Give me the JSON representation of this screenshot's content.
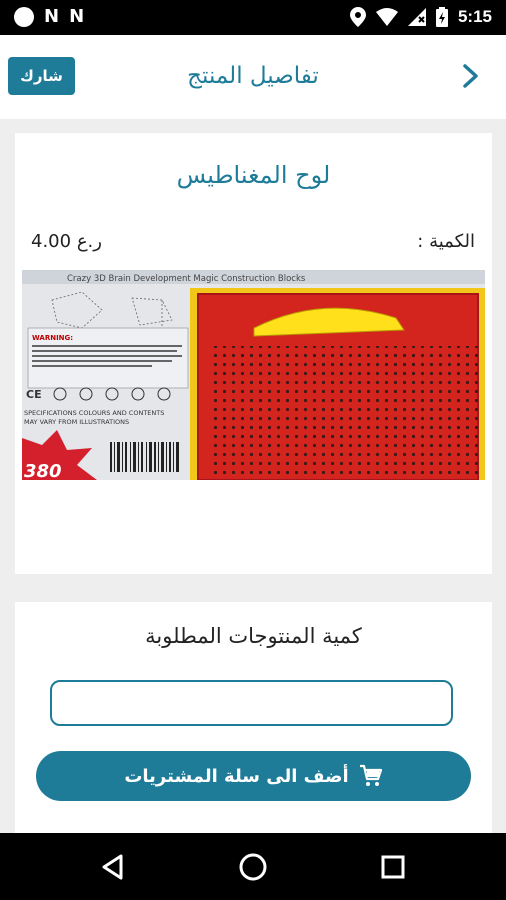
{
  "status_bar": {
    "time": "5:15",
    "left_icons": [
      "circle-icon",
      "n-icon",
      "n-icon"
    ],
    "left_letters": [
      "N",
      "N"
    ],
    "right_icons": [
      "location-icon",
      "wifi-icon",
      "signal-icon",
      "battery-icon"
    ]
  },
  "app_bar": {
    "title": "تفاصيل المنتج",
    "share_label": "شارك",
    "back_icon": "chevron-right-icon"
  },
  "product": {
    "name": "لوح المغناطيس",
    "quantity_label": "الكمية :",
    "price": "4.00 ر.ع",
    "image_texts": {
      "top_banner": "Crazy 3D Brain Development Magic Construction Blocks",
      "warning_label": "WARNING:",
      "spec_line_1": "SPECIFICATIONS COLOURS AND CONTENTS",
      "spec_line_2": "MAY VARY FROM ILLUSTRATIONS",
      "corner_number": "380"
    }
  },
  "order": {
    "heading": "كمية المنتوجات المطلوبة",
    "quantity_value": "",
    "quantity_placeholder": "",
    "add_to_cart_label": "أضف الى سلة المشتريات",
    "cart_icon": "cart-icon"
  },
  "nav_bar": {
    "icons": [
      "back-triangle-icon",
      "home-circle-icon",
      "recents-square-icon"
    ]
  },
  "colors": {
    "accent": "#1f7c98",
    "background": "#eeeeee",
    "card": "#ffffff",
    "system_bar": "#000000"
  }
}
